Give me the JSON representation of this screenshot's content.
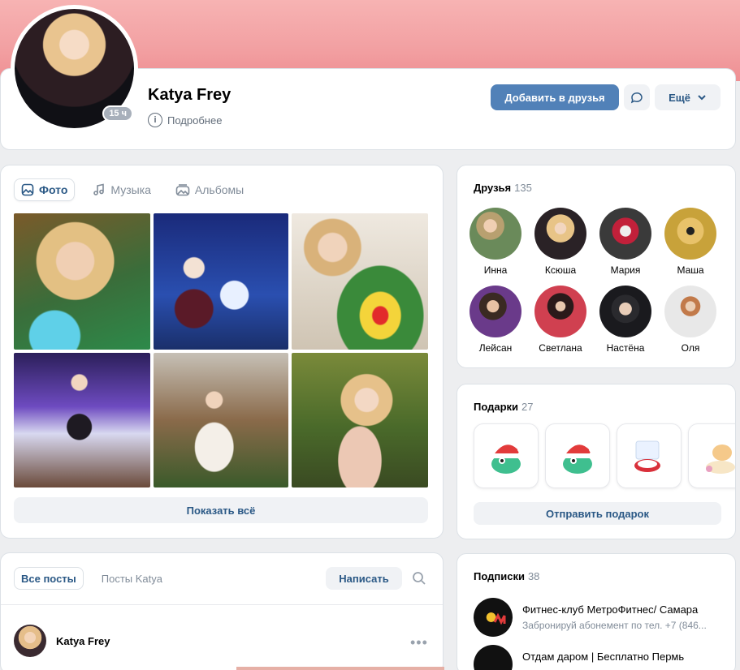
{
  "profile": {
    "name": "Katya Frey",
    "online_badge": "15 ч",
    "details_label": "Подробнее",
    "add_friend_label": "Добавить в друзья",
    "more_label": "Ещё"
  },
  "media": {
    "tabs": [
      {
        "label": "Фото",
        "icon": "image-icon"
      },
      {
        "label": "Музыка",
        "icon": "music-icon"
      },
      {
        "label": "Альбомы",
        "icon": "albums-icon"
      }
    ],
    "show_all_label": "Показать всё",
    "photo_count": 6
  },
  "friends": {
    "title": "Друзья",
    "count": "135",
    "items": [
      {
        "name": "Инна"
      },
      {
        "name": "Ксюша"
      },
      {
        "name": "Мария"
      },
      {
        "name": "Маша"
      },
      {
        "name": "Лейсан"
      },
      {
        "name": "Светлана"
      },
      {
        "name": "Настёна"
      },
      {
        "name": "Оля"
      }
    ]
  },
  "gifts": {
    "title": "Подарки",
    "count": "27",
    "send_label": "Отправить подарок"
  },
  "posts": {
    "tab_all": "Все посты",
    "tab_own": "Посты Katya",
    "write_label": "Написать",
    "author": "Katya Frey"
  },
  "subscriptions": {
    "title": "Подписки",
    "count": "38",
    "items": [
      {
        "name": "Фитнес-клуб МетроФитнес/ Самара",
        "desc": "Забронируй абонемент по тел. +7 (846..."
      },
      {
        "name": "Отдам даром | Бесплатно Пермь",
        "desc": ""
      }
    ]
  },
  "colors": {
    "accent": "#5181b8",
    "link": "#2a5885",
    "cover": "#f2a0a2"
  }
}
